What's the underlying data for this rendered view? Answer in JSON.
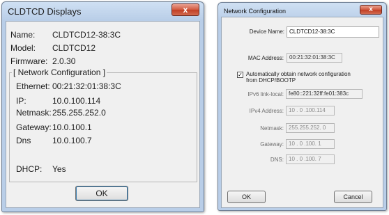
{
  "left_window": {
    "title": "CLDTCD Displays",
    "close_glyph": "x",
    "name_label": "Name:",
    "name_value": "CLDTCD12-38:3C",
    "model_label": "Model:",
    "model_value": "CLDTCD12",
    "firmware_label": "Firmware:",
    "firmware_value": "2.0.30",
    "group_title": "[ Network Configuration ]",
    "ethernet_label": "Ethernet:",
    "ethernet_value": "00:21:32:01:38:3C",
    "ip_label": "IP:",
    "ip_value": "10.0.100.114",
    "netmask_label": "Netmask:",
    "netmask_value": "255.255.252.0",
    "gateway_label": "Gateway:",
    "gateway_value": "10.0.100.1",
    "dns_label": "Dns",
    "dns_value": "10.0.100.7",
    "dhcp_label": "DHCP:",
    "dhcp_value": "Yes",
    "ok_label": "OK"
  },
  "right_window": {
    "title": "Network Configuration",
    "close_glyph": "x",
    "device_name_label": "Device Name:",
    "device_name_value": "CLDTCD12-38:3C",
    "mac_label": "MAC Address:",
    "mac_value": "00:21:32:01:38:3C",
    "dhcp_checkbox_label_line1": "Automatically obtain network configuration",
    "dhcp_checkbox_label_line2": "from DHCP/BOOTP",
    "dhcp_checked": true,
    "ipv6_label": "IPv6 link-local:",
    "ipv6_value": "fe80::221:32ff:fe01:383c",
    "ipv4_label": "IPv4 Address:",
    "ipv4_value": "10 . 0 .100.114",
    "netmask_label": "Netmask:",
    "netmask_value": "255.255.252. 0",
    "gateway_label": "Gateway:",
    "gateway_value": "10 . 0 .100. 1",
    "dns_label": "DNS:",
    "dns_value": "10 . 0 .100. 7",
    "ok_label": "OK",
    "cancel_label": "Cancel"
  }
}
